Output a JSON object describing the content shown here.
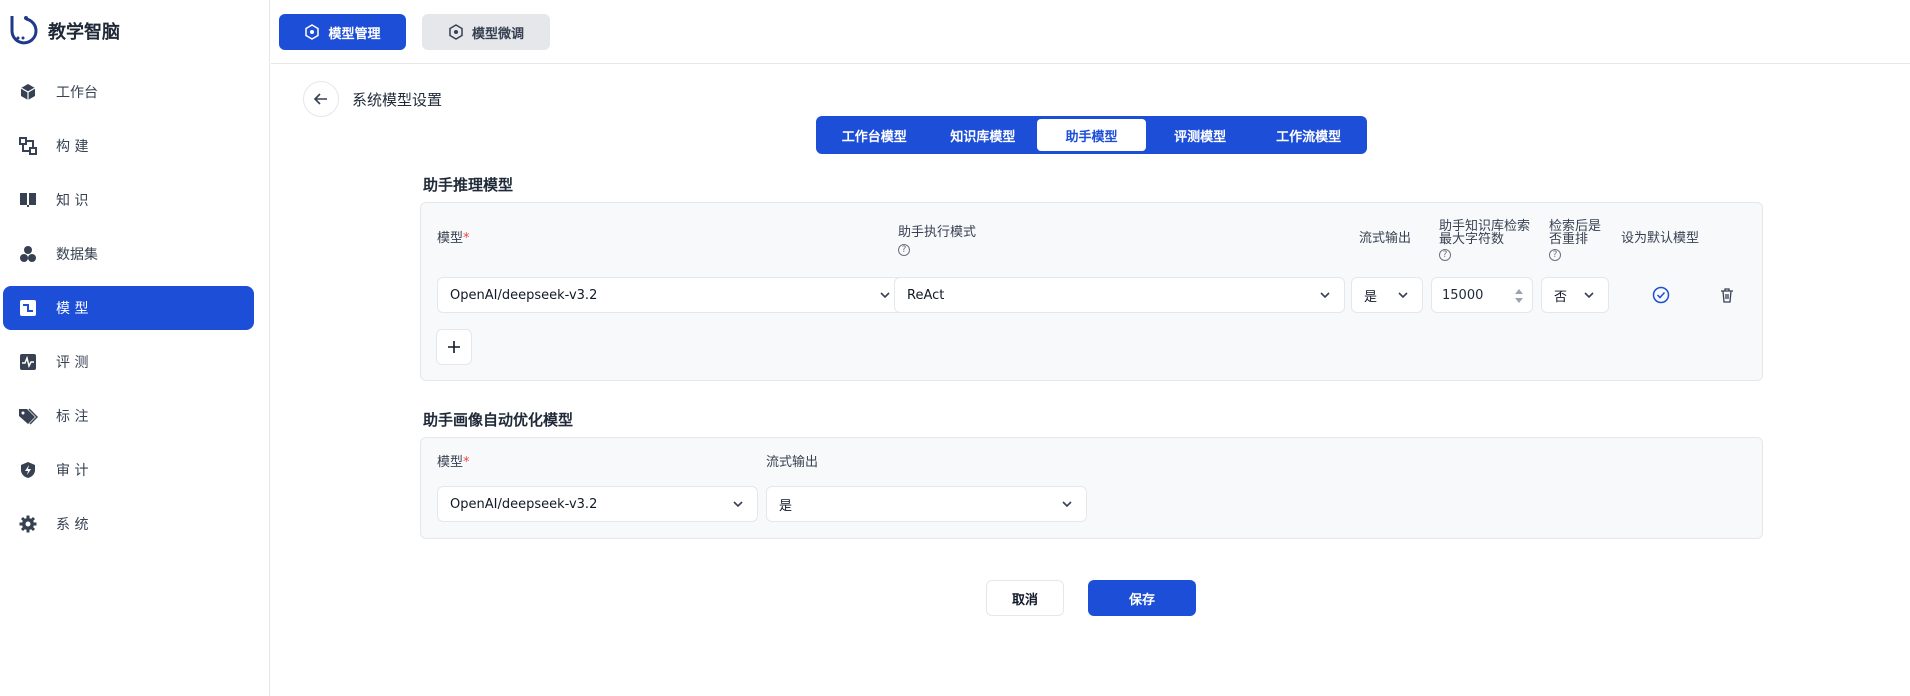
{
  "app": {
    "title": "教学智脑"
  },
  "sidebar": {
    "items": [
      {
        "label": "工作台",
        "icon": "cube-icon"
      },
      {
        "label": "构  建",
        "icon": "build-icon"
      },
      {
        "label": "知  识",
        "icon": "book-icon"
      },
      {
        "label": "数据集",
        "icon": "dataset-icon"
      },
      {
        "label": "模  型",
        "icon": "model-icon",
        "active": true
      },
      {
        "label": "评  测",
        "icon": "pulse-icon"
      },
      {
        "label": "标  注",
        "icon": "tag-icon"
      },
      {
        "label": "审  计",
        "icon": "shield-icon"
      },
      {
        "label": "系  统",
        "icon": "gear-icon"
      }
    ]
  },
  "topbar": {
    "tab_manage": "模型管理",
    "tab_finetune": "模型微调"
  },
  "page": {
    "title": "系统模型设置"
  },
  "segments": [
    "工作台模型",
    "知识库模型",
    "助手模型",
    "评测模型",
    "工作流模型"
  ],
  "reasoning": {
    "title": "助手推理模型",
    "labels": {
      "model": "模型",
      "mode": "助手执行模式",
      "stream": "流式输出",
      "maxchars_1": "助手知识库检索",
      "maxchars_2": "最大字符数",
      "rerank_1": "检索后是",
      "rerank_2": "否重排",
      "default": "设为默认模型"
    },
    "row": {
      "model": "OpenAI/deepseek-v3.2",
      "mode": "ReAct",
      "stream": "是",
      "maxchars": "15000",
      "rerank": "否"
    }
  },
  "portrait": {
    "title": "助手画像自动优化模型",
    "labels": {
      "model": "模型",
      "stream": "流式输出"
    },
    "row": {
      "model": "OpenAI/deepseek-v3.2",
      "stream": "是"
    }
  },
  "required_mark": "*",
  "help_mark": "?",
  "actions": {
    "cancel": "取消",
    "save": "保存"
  },
  "colors": {
    "accent": "#1d4ed8",
    "required": "#ef4444"
  }
}
